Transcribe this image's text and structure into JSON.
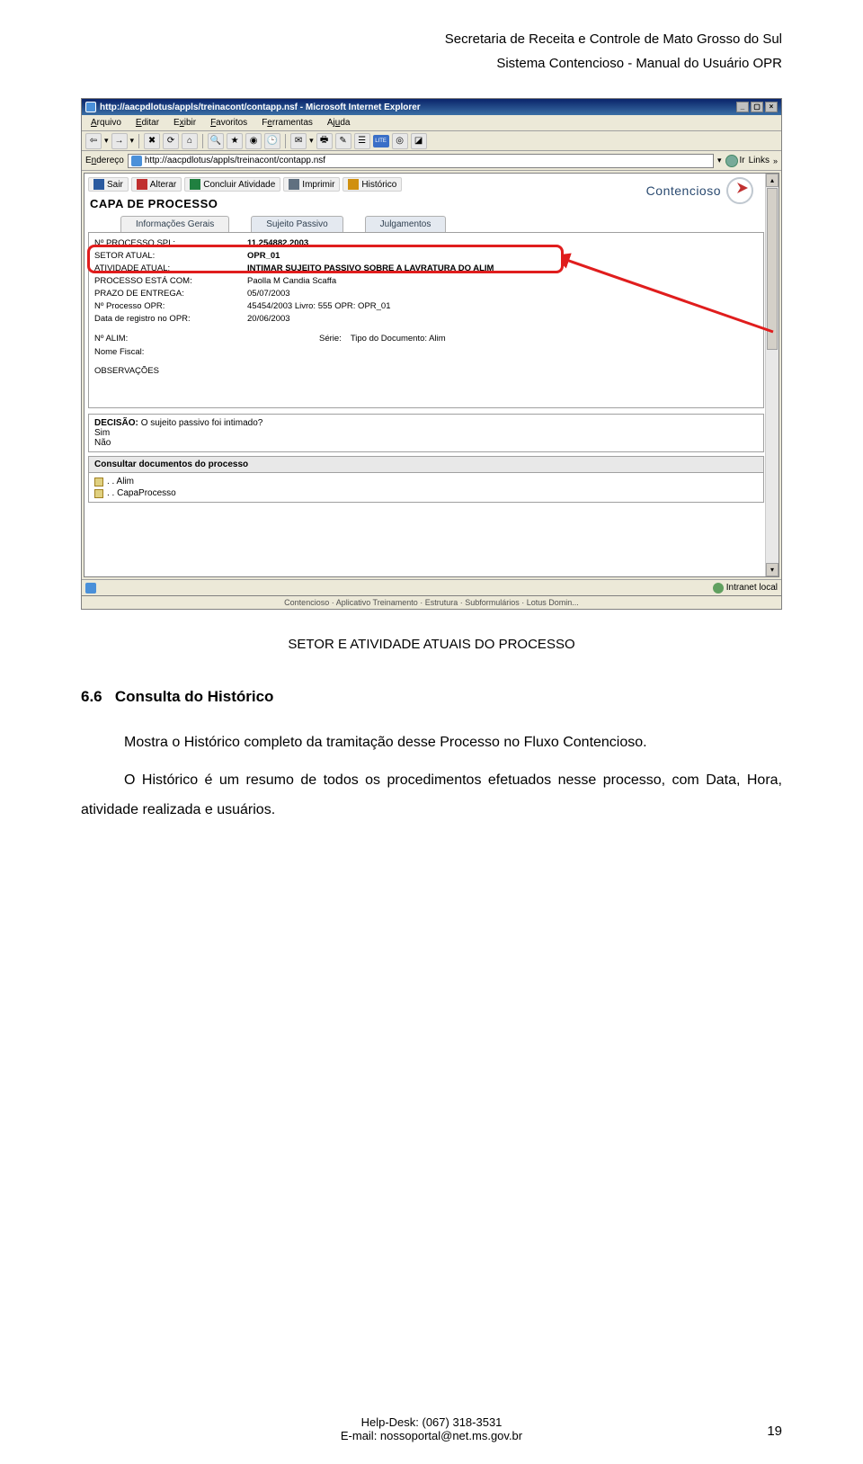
{
  "doc_header": {
    "line1": "Secretaria de Receita e Controle de Mato Grosso do Sul",
    "line2": "Sistema Contencioso - Manual do Usuário OPR"
  },
  "caption": "SETOR E ATIVIDADE ATUAIS DO PROCESSO",
  "section": {
    "number": "6.6",
    "title": "Consulta do Histórico"
  },
  "body": {
    "p1": "Mostra o Histórico completo da tramitação desse Processo no Fluxo Contencioso.",
    "p2": "O Histórico é um resumo de todos os procedimentos efetuados nesse processo, com Data, Hora, atividade realizada e usuários."
  },
  "footer": {
    "helpdesk": "Help-Desk: (067) 318-3531",
    "email": "E-mail: nossoportal@net.ms.gov.br",
    "page": "19"
  },
  "browser": {
    "title": "http://aacpdlotus/appls/treinacont/contapp.nsf - Microsoft Internet Explorer",
    "menu": [
      "Arquivo",
      "Editar",
      "Exibir",
      "Favoritos",
      "Ferramentas",
      "Ajuda"
    ],
    "address_label": "Endereço",
    "url": "http://aacpdlotus/appls/treinacont/contapp.nsf",
    "go": "Ir",
    "links": "Links",
    "status_left": "",
    "status_zone": "Intranet local"
  },
  "app": {
    "buttons": {
      "sair": "Sair",
      "alterar": "Alterar",
      "concluir": "Concluir Atividade",
      "imprimir": "Imprimir",
      "historico": "Histórico"
    },
    "logo": "Contencioso",
    "title": "CAPA DE PROCESSO",
    "tabs": [
      "Informações Gerais",
      "Sujeito Passivo",
      "Julgamentos"
    ],
    "fields": {
      "spi_label": "Nº PROCESSO SPI :",
      "spi_value": "11.254882.2003",
      "setor_label": "SETOR ATUAL:",
      "setor_value": "OPR_01",
      "atividade_label": "ATIVIDADE ATUAL:",
      "atividade_value": "INTIMAR SUJEITO PASSIVO SOBRE A LAVRATURA DO ALIM",
      "processo_com_label": "PROCESSO ESTÁ COM:",
      "processo_com_value": "Paolla M Candia Scaffa",
      "prazo_label": "PRAZO DE ENTREGA:",
      "prazo_value": "05/07/2003",
      "opr_label": "Nº Processo OPR:",
      "opr_value": "45454/2003 Livro: 555 OPR: OPR_01",
      "registro_label": "Data de registro no OPR:",
      "registro_value": "20/06/2003",
      "alim_label": "Nº ALIM:",
      "alim_value": "",
      "serie_label": "Série:",
      "serie_value": "",
      "tipodoc_label": "Tipo do Documento: Alim",
      "nome_fiscal_label": "Nome Fiscal:",
      "obs_label": "OBSERVAÇÕES"
    },
    "decisao": {
      "title": "DECISÃO:",
      "question": " O sujeito passivo foi intimado?",
      "opt1": "Sim",
      "opt2": "Não"
    },
    "consult_label": "Consultar documentos do processo",
    "docs": [
      ". . Alim",
      ". . CapaProcesso"
    ]
  }
}
